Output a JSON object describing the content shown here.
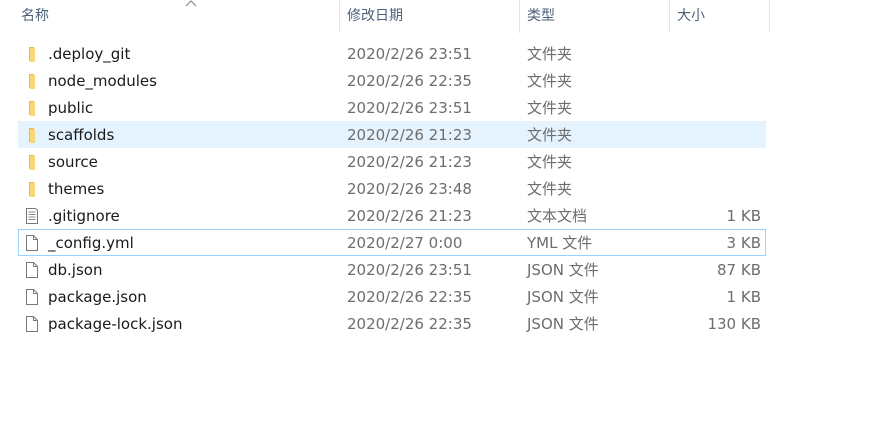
{
  "columns": {
    "name": "名称",
    "date": "修改日期",
    "type": "类型",
    "size": "大小"
  },
  "files": [
    {
      "name": ".deploy_git",
      "date": "2020/2/26 23:51",
      "type": "文件夹",
      "size": "",
      "icon": "folder-icon"
    },
    {
      "name": "node_modules",
      "date": "2020/2/26 22:35",
      "type": "文件夹",
      "size": "",
      "icon": "folder-icon"
    },
    {
      "name": "public",
      "date": "2020/2/26 23:51",
      "type": "文件夹",
      "size": "",
      "icon": "folder-icon"
    },
    {
      "name": "scaffolds",
      "date": "2020/2/26 21:23",
      "type": "文件夹",
      "size": "",
      "icon": "folder-icon",
      "selected": true
    },
    {
      "name": "source",
      "date": "2020/2/26 21:23",
      "type": "文件夹",
      "size": "",
      "icon": "folder-icon"
    },
    {
      "name": "themes",
      "date": "2020/2/26 23:48",
      "type": "文件夹",
      "size": "",
      "icon": "folder-icon"
    },
    {
      "name": ".gitignore",
      "date": "2020/2/26 21:23",
      "type": "文本文档",
      "size": "1 KB",
      "icon": "text-document-icon"
    },
    {
      "name": "_config.yml",
      "date": "2020/2/27 0:00",
      "type": "YML 文件",
      "size": "3 KB",
      "icon": "file-icon",
      "focused": true
    },
    {
      "name": "db.json",
      "date": "2020/2/26 23:51",
      "type": "JSON 文件",
      "size": "87 KB",
      "icon": "file-icon"
    },
    {
      "name": "package.json",
      "date": "2020/2/26 22:35",
      "type": "JSON 文件",
      "size": "1 KB",
      "icon": "file-icon"
    },
    {
      "name": "package-lock.json",
      "date": "2020/2/26 22:35",
      "type": "JSON 文件",
      "size": "130 KB",
      "icon": "file-icon"
    }
  ],
  "colors": {
    "header_text": "#4c607a",
    "selected_bg": "#e5f3ff",
    "focus_border": "#99d1ff",
    "folder": "#f8d775"
  }
}
